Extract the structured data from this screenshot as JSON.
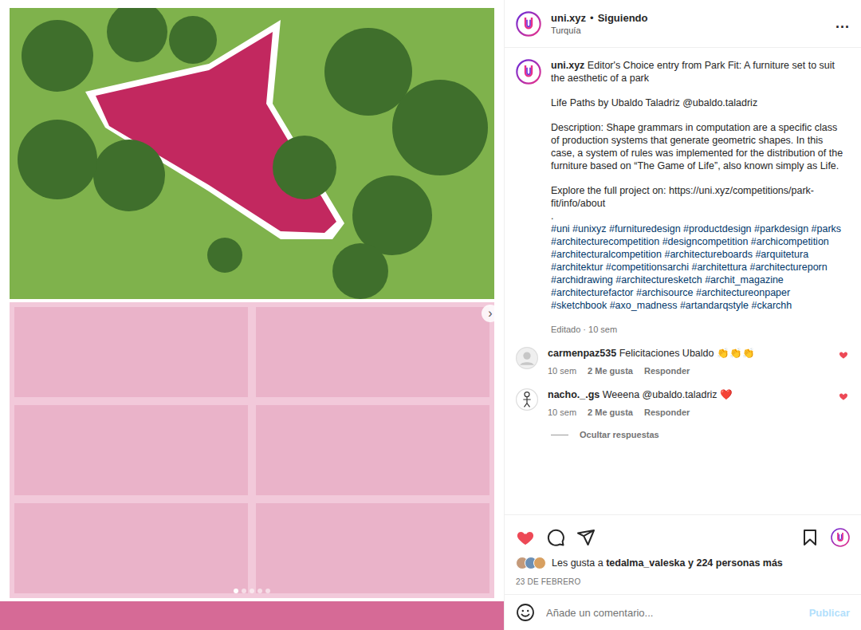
{
  "media": {
    "next": "›",
    "dots": [
      {
        "selected": true
      },
      {
        "selected": false
      },
      {
        "selected": false
      },
      {
        "selected": false
      },
      {
        "selected": false
      }
    ]
  },
  "header": {
    "username": "uni.xyz",
    "separator": "•",
    "follow": "Siguiendo",
    "location": "Turquía",
    "more": "..."
  },
  "caption": {
    "username": "uni.xyz",
    "paragraphs": [
      "Editor's Choice entry from Park Fit: A furniture set to suit the aesthetic of a park",
      "Life Paths by Ubaldo Taladriz @ubaldo.taladriz",
      "Description: Shape grammars in computation are a specific class of production systems that generate geometric shapes. In this case, a system of rules was implemented for the distribution of the furniture based on “The Game of Life”, also known simply as Life.",
      "Explore the full project on: https://uni.xyz/competitions/park-fit/info/about"
    ],
    "dot": ".",
    "hashtags": "#uni #unixyz #furnituredesign #productdesign #parkdesign #parks #architecturecompetition #designcompetition #archicompetition #architecturalcompetition #architectureboards #arquitetura #architektur #competitionsarchi #architettura #architectureporn #archidrawing #architecturesketch #archit_magazine #architecturefactor #archisource #architectureonpaper #sketchbook #axo_madness #artandarqstyle #ckarchh",
    "edited": "Editado · 10 sem"
  },
  "comments": [
    {
      "kind": "blank",
      "username": "carmenpaz535",
      "text": "Felicitaciones Ubaldo 👏👏👏",
      "time": "10 sem",
      "likes": "2 Me gusta",
      "reply": "Responder",
      "liked": true
    },
    {
      "kind": "figure",
      "username": "nacho._.gs",
      "text": "Weeena @ubaldo.taladriz ❤️",
      "time": "10 sem",
      "likes": "2 Me gusta",
      "reply": "Responder",
      "liked": true
    }
  ],
  "replies_toggle": "Ocultar respuestas",
  "actions": {
    "liked": true,
    "saved": false
  },
  "likes": {
    "prefix": "Les gusta a",
    "user": "tedalma_valeska",
    "suffix": "y 224 personas más"
  },
  "date": "23 DE FEBRERO",
  "comment_box": {
    "placeholder": "Añade un comentario...",
    "post": "Publicar"
  }
}
